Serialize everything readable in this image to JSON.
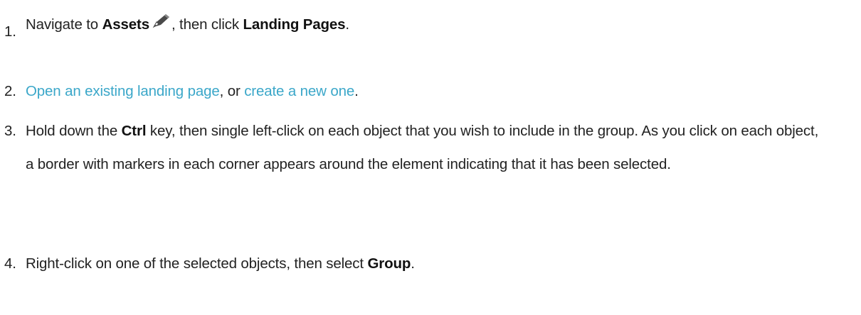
{
  "steps": [
    {
      "number": "1.",
      "text_a": "Navigate to ",
      "bold_assets": "Assets",
      "icon": "pencil-icon",
      "text_b": ", then click ",
      "bold_landing_pages": "Landing Pages",
      "text_c": "."
    },
    {
      "number": "2.",
      "link_open": "Open an existing landing page",
      "text_a": ", or ",
      "link_create": "create a new one",
      "text_b": "."
    },
    {
      "number": "3.",
      "text_a": "Hold down the ",
      "bold_ctrl": "Ctrl",
      "text_b": " key, then single left-click on each object that you wish to include in the group. As you click on each object, a border with markers in each corner appears around the element indicating that it has been selected."
    },
    {
      "number": "4.",
      "text_a": "Right-click on one of the selected objects, then select ",
      "bold_group": "Group",
      "text_b": "."
    }
  ],
  "colors": {
    "link": "#3ba7c9",
    "text": "#222222",
    "icon": "#4a4a4a"
  }
}
